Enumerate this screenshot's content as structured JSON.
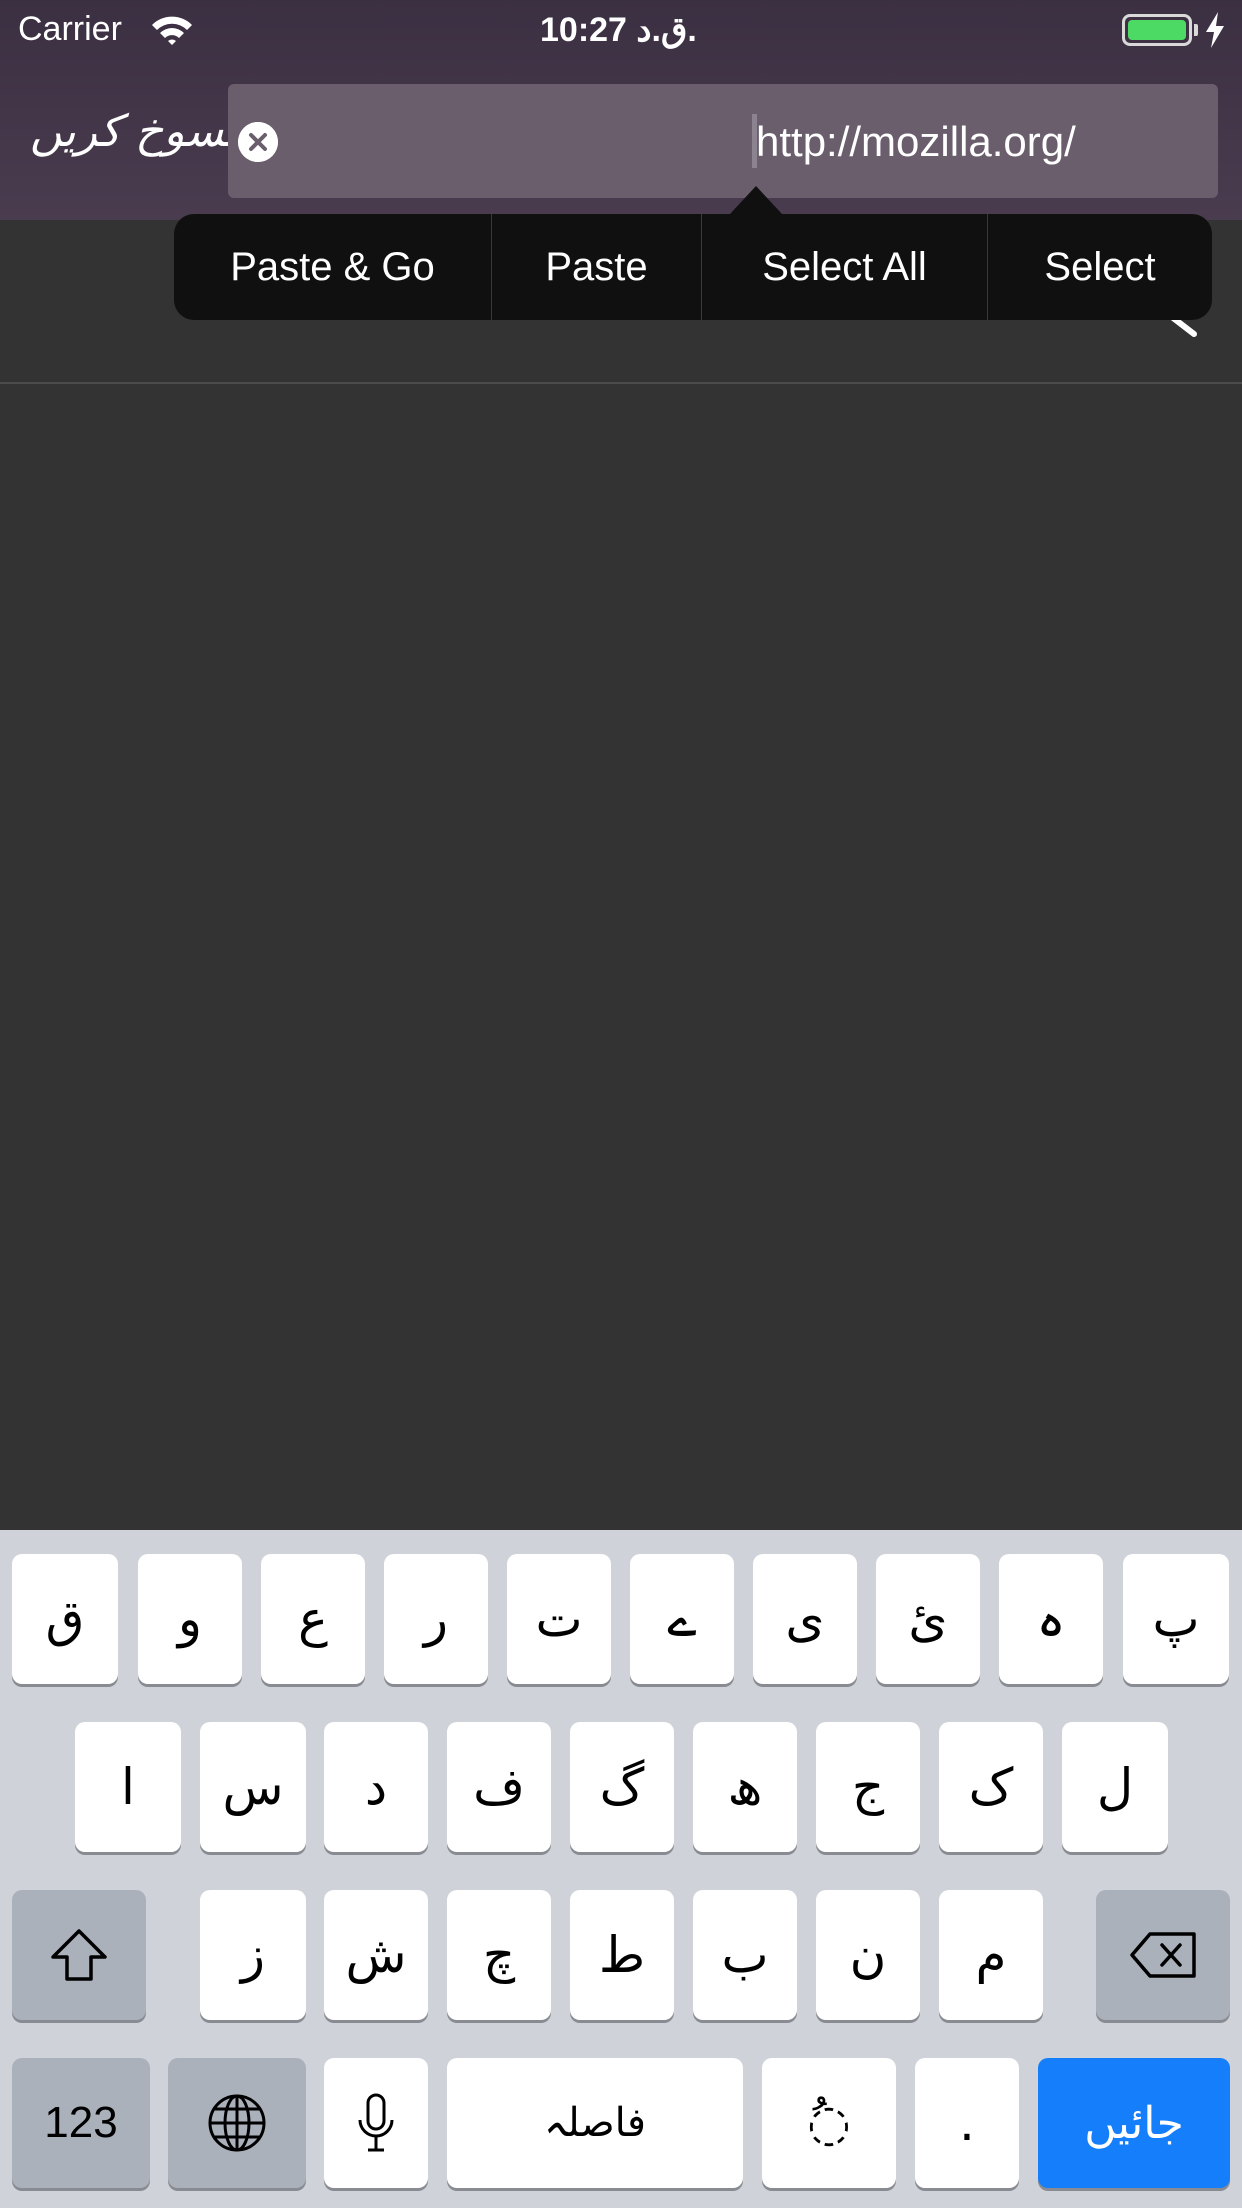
{
  "status_bar": {
    "carrier": "Carrier",
    "time": "10:27 ق.د.",
    "battery_level": 1.0,
    "charging": true
  },
  "url_bar": {
    "cancel_label": "منسوخ کریں",
    "url": "http://mozilla.org/"
  },
  "edit_menu": {
    "items": [
      "Paste & Go",
      "Paste",
      "Select All",
      "Select"
    ]
  },
  "keyboard": {
    "row1": [
      "ق",
      "و",
      "ع",
      "ر",
      "ت",
      "ے",
      "ی",
      "ئ",
      "ہ",
      "پ"
    ],
    "row2": [
      "ا",
      "س",
      "د",
      "ف",
      "گ",
      "ھ",
      "ج",
      "ک",
      "ل"
    ],
    "row3": [
      "ز",
      "ش",
      "چ",
      "ط",
      "ب",
      "ن",
      "م"
    ],
    "numbers_label": "123",
    "space_label": "فاصلہ",
    "diacritic_label": "ُ◌",
    "period_label": ".",
    "go_label": "جائیں"
  },
  "colors": {
    "header": "#4a3c4f",
    "content_bg": "#333333",
    "go_key": "#147efb",
    "battery": "#4cd964"
  }
}
